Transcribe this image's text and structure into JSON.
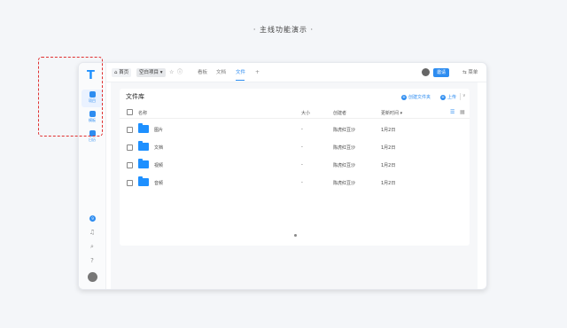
{
  "banner": "· 主线功能演示 ·",
  "app": {
    "logo": "T",
    "sidebar": {
      "items": [
        {
          "label": "项目"
        },
        {
          "label": "模板"
        },
        {
          "label": "日历"
        }
      ],
      "badge": "9"
    },
    "topbar": {
      "home_label": "首页",
      "project_label": "空白项目",
      "nav_tabs": [
        {
          "label": "看板"
        },
        {
          "label": "文档"
        },
        {
          "label": "文件"
        }
      ],
      "active_tab": "文件",
      "invite_label": "邀请",
      "more_label": "菜单"
    },
    "library": {
      "title": "文件库",
      "create_folder_label": "创建文件夹",
      "upload_label": "上传",
      "columns": [
        "名称",
        "大小",
        "创建者",
        "更新时间"
      ],
      "rows": [
        {
          "name": "图片",
          "size": "-",
          "creator": "陈虎红豆沙",
          "updated": "1月2日"
        },
        {
          "name": "文档",
          "size": "-",
          "creator": "陈虎红豆沙",
          "updated": "1月2日"
        },
        {
          "name": "视频",
          "size": "-",
          "creator": "陈虎红豆沙",
          "updated": "1月2日"
        },
        {
          "name": "音频",
          "size": "-",
          "creator": "陈虎红豆沙",
          "updated": "1月2日"
        }
      ]
    }
  },
  "colors": {
    "accent": "#2d8cf0",
    "folder": "#1e90ff",
    "highlight": "#e03131"
  }
}
